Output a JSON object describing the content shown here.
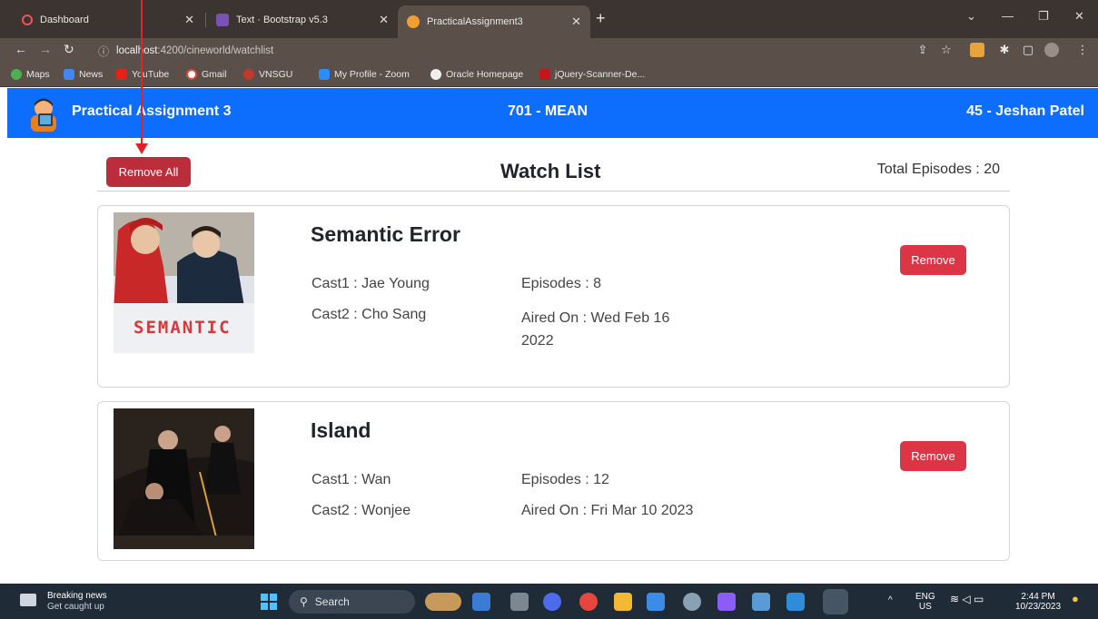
{
  "browser": {
    "tabs": [
      {
        "label": "Dashboard"
      },
      {
        "label": "Text · Bootstrap v5.3"
      },
      {
        "label": "PracticalAssignment3"
      }
    ],
    "url_host": "localhost",
    "url_path": ":4200/cineworld/watchlist",
    "bookmarks": [
      "Maps",
      "News",
      "YouTube",
      "Gmail",
      "VNSGU",
      "My Profile - Zoom",
      "Oracle Homepage",
      "jQuery-Scanner-De..."
    ]
  },
  "navbar": {
    "brand": "Practical Assignment 3",
    "center": "701 - MEAN",
    "right": "45 - Jeshan Patel"
  },
  "watchlist": {
    "remove_all": "Remove All",
    "title": "Watch List",
    "total": "Total Episodes : 20",
    "items": [
      {
        "title": "Semantic Error",
        "cast1": "Cast1 : Jae Young",
        "cast2": "Cast2 : Cho Sang",
        "episodes": "Episodes : 8",
        "aired": "Aired On : Wed Feb 16 2022",
        "poster_text": "SEMANTIC",
        "remove": "Remove"
      },
      {
        "title": "Island",
        "cast1": "Cast1 : Wan",
        "cast2": "Cast2 : Wonjee",
        "episodes": "Episodes : 12",
        "aired": "Aired On : Fri Mar 10 2023",
        "remove": "Remove"
      }
    ]
  },
  "taskbar": {
    "news_title": "Breaking news",
    "news_sub": "Get caught up",
    "search": "Search",
    "lang1": "ENG",
    "lang2": "US",
    "time": "2:44 PM",
    "date": "10/23/2023"
  },
  "colors": {
    "navbar": "#0d6efd",
    "danger": "#dc3545",
    "annotation": "#e0232a"
  }
}
